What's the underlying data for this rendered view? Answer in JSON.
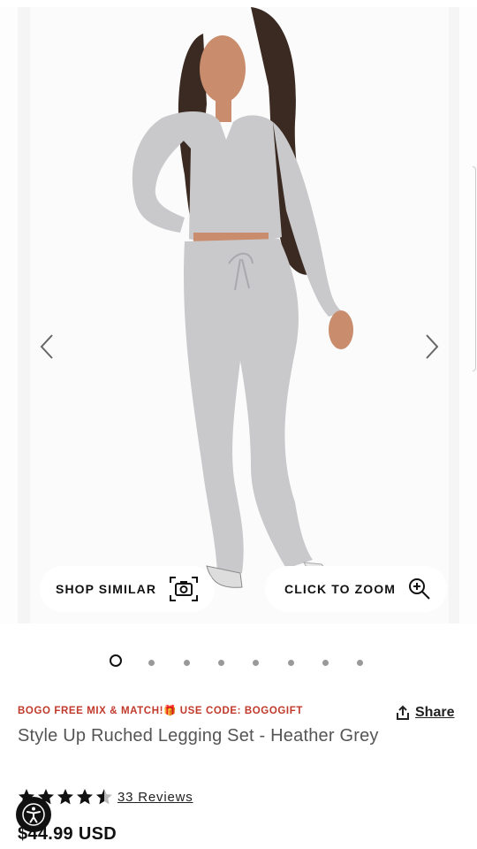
{
  "gallery": {
    "shop_similar_label": "SHOP SIMILAR",
    "click_to_zoom_label": "CLICK TO ZOOM",
    "active_slide": 1,
    "slide_count": 8
  },
  "product": {
    "promo": "BOGO FREE MIX & MATCH!🎁 USE CODE: BOGOGIFT",
    "share_label": "Share",
    "title": "Style Up Ruched Legging Set - Heather Grey",
    "rating": 4.5,
    "reviews_label": "33 Reviews",
    "price": "$44.99 USD"
  },
  "colors": {
    "promo": "#c0392b",
    "garment": "#c9c9cc"
  }
}
